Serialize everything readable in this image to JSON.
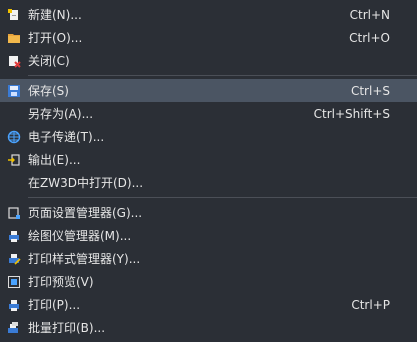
{
  "menu": {
    "items": [
      {
        "label": "新建(N)...",
        "shortcut": "Ctrl+N",
        "icon": "new-file-icon"
      },
      {
        "label": "打开(O)...",
        "shortcut": "Ctrl+O",
        "icon": "folder-open-icon"
      },
      {
        "label": "关闭(C)",
        "shortcut": "",
        "icon": "close-file-icon"
      },
      {
        "label": "保存(S)",
        "shortcut": "Ctrl+S",
        "icon": "save-icon",
        "selected": true
      },
      {
        "label": "另存为(A)...",
        "shortcut": "Ctrl+Shift+S",
        "icon": ""
      },
      {
        "label": "电子传递(T)...",
        "shortcut": "",
        "icon": "globe-icon"
      },
      {
        "label": "输出(E)...",
        "shortcut": "",
        "icon": "export-icon"
      },
      {
        "label": "在ZW3D中打开(D)...",
        "shortcut": "",
        "icon": ""
      },
      {
        "label": "页面设置管理器(G)...",
        "shortcut": "",
        "icon": "page-setup-icon"
      },
      {
        "label": "绘图仪管理器(M)...",
        "shortcut": "",
        "icon": "plotter-icon"
      },
      {
        "label": "打印样式管理器(Y)...",
        "shortcut": "",
        "icon": "print-style-icon"
      },
      {
        "label": "打印预览(V)",
        "shortcut": "",
        "icon": "print-preview-icon"
      },
      {
        "label": "打印(P)...",
        "shortcut": "Ctrl+P",
        "icon": "print-icon"
      },
      {
        "label": "批量打印(B)...",
        "shortcut": "",
        "icon": "batch-print-icon"
      }
    ]
  },
  "colors": {
    "background": "#2b2f36",
    "selected": "#4b5563",
    "text": "#e6e6e6",
    "separator": "#4b4f57"
  }
}
